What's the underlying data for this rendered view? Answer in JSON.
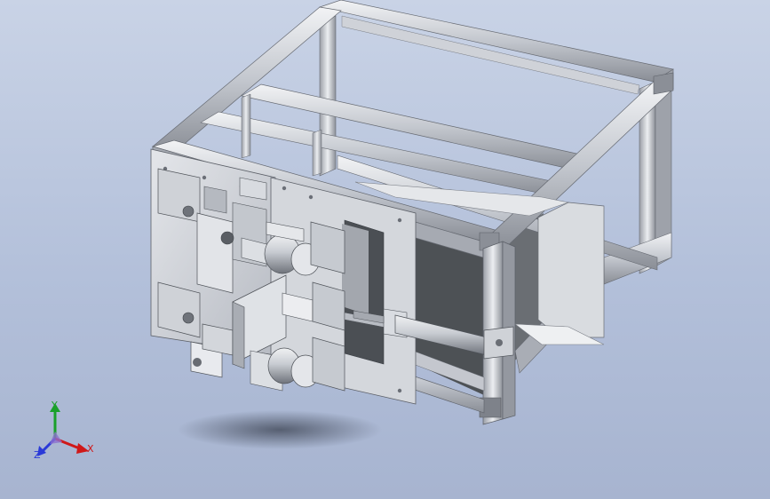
{
  "app": {
    "view": "isometric-3d-model"
  },
  "triad": {
    "x_label": "X",
    "y_label": "Y",
    "z_label": "Z",
    "colors": {
      "x": "#d01818",
      "y": "#1aa02a",
      "z": "#2a3ad8"
    }
  },
  "colors": {
    "background_top": "#c9d3e6",
    "background_bottom": "#a7b4d0",
    "frame_light": "#e6e8ec",
    "frame_mid": "#b9bdc5",
    "frame_dark": "#7c8089",
    "panel_dark": "#505458"
  }
}
